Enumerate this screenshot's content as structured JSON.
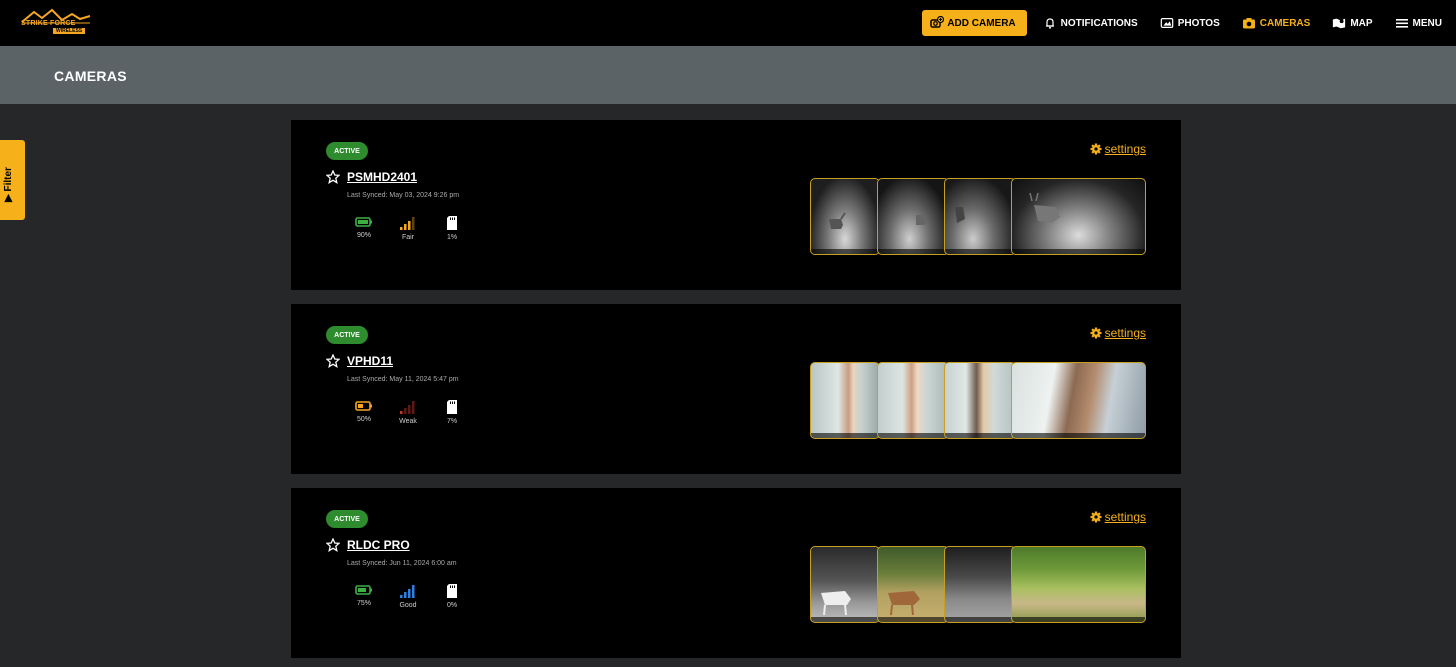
{
  "brand": {
    "name": "STRIKE FORCE",
    "sub": "WIRELESS"
  },
  "nav": {
    "add_camera": "ADD CAMERA",
    "notifications": "NOTIFICATIONS",
    "photos": "PHOTOS",
    "cameras": "CAMERAS",
    "map": "MAP",
    "menu": "MENU"
  },
  "page": {
    "title": "CAMERAS"
  },
  "filter": {
    "label": "Filter"
  },
  "colors": {
    "accent": "#f5b01a",
    "active": "#2e8b2e"
  },
  "cameras": [
    {
      "status": "ACTIVE",
      "name": "PSMHD2401",
      "last_synced": "Last Synced: May 03, 2024 9:26 pm",
      "battery": "90%",
      "battery_level": 0.9,
      "signal": "Fair",
      "signal_bars": 3,
      "storage": "1%",
      "settings_label": "settings",
      "thumbs": [
        "night-deer-1",
        "night-deer-2",
        "night-deer-3",
        "night-deer-4"
      ]
    },
    {
      "status": "ACTIVE",
      "name": "VPHD11",
      "last_synced": "Last Synced: May 11, 2024 5:47 pm",
      "battery": "50%",
      "battery_level": 0.5,
      "signal": "Weak",
      "signal_bars": 1,
      "storage": "7%",
      "settings_label": "settings",
      "thumbs": [
        "closeup-bark-1",
        "closeup-bark-2",
        "closeup-bark-3",
        "closeup-bark-4"
      ]
    },
    {
      "status": "ACTIVE",
      "name": "RLDC PRO",
      "last_synced": "Last Synced: Jun 11, 2024 6:00 am",
      "battery": "75%",
      "battery_level": 0.75,
      "signal": "Good",
      "signal_bars": 4,
      "storage": "0%",
      "settings_label": "settings",
      "thumbs": [
        "ir-deer",
        "day-deer",
        "ir-field",
        "day-field"
      ]
    }
  ]
}
